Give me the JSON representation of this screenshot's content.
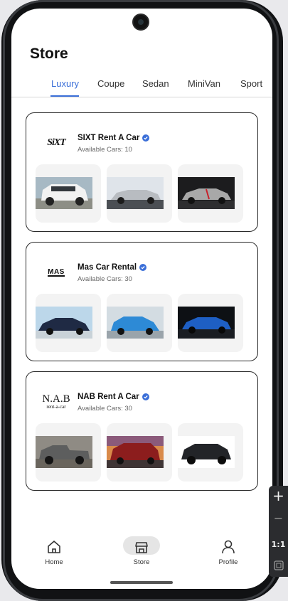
{
  "header": {
    "title": "Store"
  },
  "tabs": [
    {
      "label": "Luxury"
    },
    {
      "label": "Coupe"
    },
    {
      "label": "Sedan"
    },
    {
      "label": "MiniVan"
    },
    {
      "label": "Sport"
    }
  ],
  "active_tab": "Luxury",
  "stores": [
    {
      "name": "SIXT Rent A Car",
      "logo_text": "SiXT",
      "available": "Available Cars: 10",
      "cars": [
        {
          "icon": "white-suv-image",
          "color": "#e8e8e8"
        },
        {
          "icon": "silver-convertible-image",
          "color": "#b8bcc1"
        },
        {
          "icon": "silver-sports-car-image",
          "color": "#a8a8a8"
        }
      ]
    },
    {
      "name": "Mas Car Rental",
      "logo_text": "MAS",
      "available": "Available Cars: 30",
      "cars": [
        {
          "icon": "dark-blue-sedan-image",
          "color": "#1f2a44"
        },
        {
          "icon": "blue-hatchback-image",
          "color": "#2d8ad6"
        },
        {
          "icon": "blue-sedan-image",
          "color": "#1e5fc4"
        }
      ]
    },
    {
      "name": "NAB Rent A Car",
      "logo_text": "N.A.B",
      "logo_subtext": "rent-a-car",
      "available": "Available Cars: 30",
      "cars": [
        {
          "icon": "grey-pickup-image",
          "color": "#7b7a75"
        },
        {
          "icon": "red-minivan-image",
          "color": "#8c1d1d"
        },
        {
          "icon": "black-suv-image",
          "color": "#222428"
        }
      ]
    }
  ],
  "nav": {
    "home": "Home",
    "store": "Store",
    "profile": "Profile"
  },
  "side_panel": {
    "zoom": "1:1"
  },
  "colors": {
    "accent": "#3b6fd8",
    "verified": "#3b6fd8"
  }
}
